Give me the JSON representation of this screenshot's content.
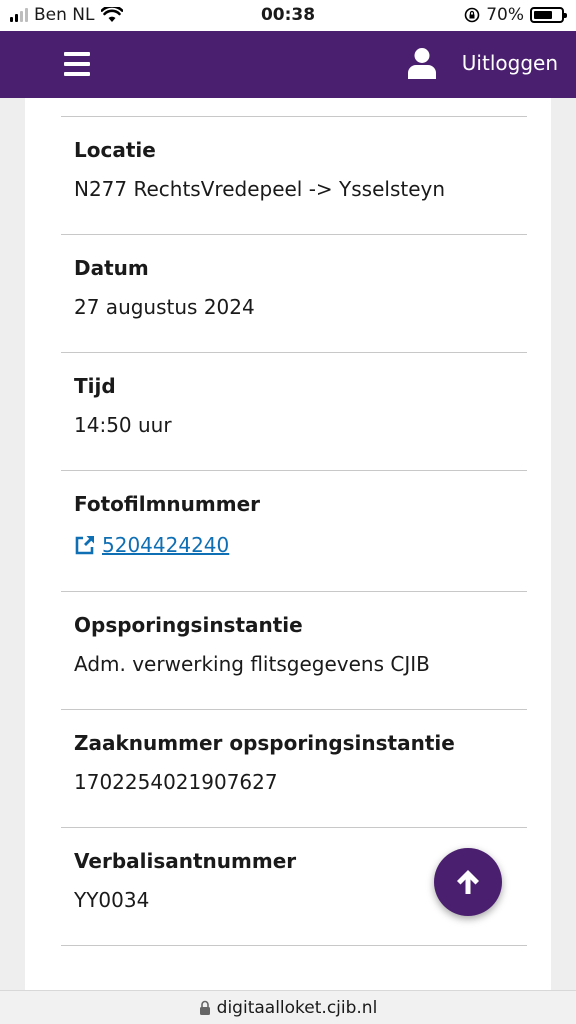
{
  "status_bar": {
    "carrier": "Ben NL",
    "time": "00:38",
    "battery": "70%",
    "battery_level": 0.7
  },
  "header": {
    "menu_icon": "hamburger-menu-icon",
    "user_icon": "user-icon",
    "logout_label": "Uitloggen"
  },
  "details": [
    {
      "label": "Locatie",
      "value": "N277 RechtsVredepeel -> Ysselsteyn"
    },
    {
      "label": "Datum",
      "value": "27 augustus 2024"
    },
    {
      "label": "Tijd",
      "value": "14:50 uur"
    },
    {
      "label": "Fotofilmnummer",
      "value": "5204424240",
      "icon": "external-link-icon"
    },
    {
      "label": "Opsporingsinstantie",
      "value": "Adm. verwerking flitsgegevens CJIB"
    },
    {
      "label": "Zaaknummer opsporingsinstantie",
      "value": "1702254021907627"
    },
    {
      "label": "Verbalisantnummer",
      "value": "YY0034"
    }
  ],
  "scroll_top": {
    "icon": "arrow-up-icon"
  },
  "url_bar": {
    "url": "digitaalloket.cjib.nl",
    "icon": "lock-icon"
  },
  "colors": {
    "brand": "#4b1f6f",
    "link": "#0f6fb4",
    "divider": "#c8c8c8"
  }
}
